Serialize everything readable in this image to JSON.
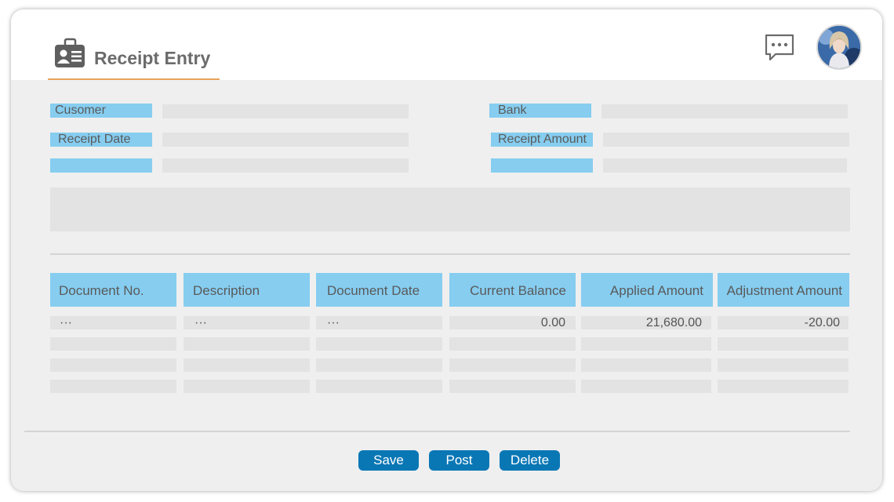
{
  "header": {
    "title": "Receipt Entry",
    "title_icon": "id-card-icon",
    "chat_icon": "chat-bubble-icon",
    "accent_color": "#e8a25a"
  },
  "form": {
    "customer_label": "Cusomer",
    "receipt_date_label": "Receipt Date",
    "extra_left_label": "",
    "bank_label": "Bank",
    "receipt_amount_label": "Receipt Amount",
    "extra_right_label": ""
  },
  "table": {
    "columns": [
      "Document No.",
      "Description",
      "Document Date",
      "Current Balance",
      "Applied Amount",
      "Adjustment Amount"
    ],
    "rows": [
      [
        "···",
        "···",
        "···",
        "0.00",
        "21,680.00",
        "-20.00"
      ],
      [
        "",
        "",
        "",
        "",
        "",
        ""
      ],
      [
        "",
        "",
        "",
        "",
        "",
        ""
      ],
      [
        "",
        "",
        "",
        "",
        "",
        ""
      ]
    ]
  },
  "actions": {
    "save": "Save",
    "post": "Post",
    "delete": "Delete",
    "button_color": "#0a77b5"
  },
  "colors": {
    "label_bg": "#86cdf0",
    "field_bg": "#e3e3e3",
    "panel_bg": "#efefef"
  }
}
